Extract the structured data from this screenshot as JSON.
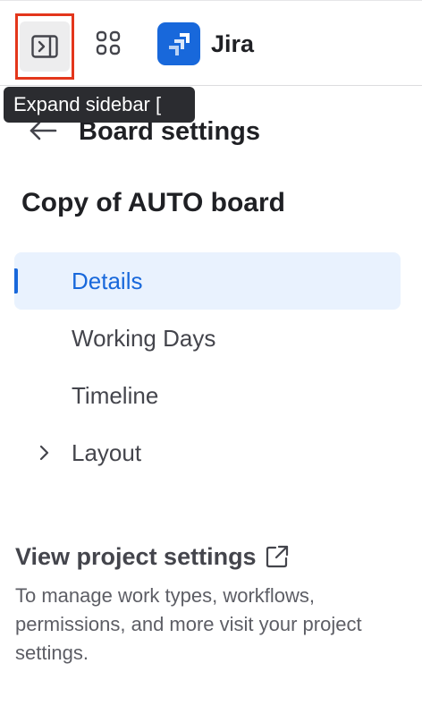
{
  "topbar": {
    "product_name": "Jira",
    "tooltip": "Expand sidebar ["
  },
  "header": {
    "title": "Board settings",
    "board_name": "Copy of AUTO board"
  },
  "nav": {
    "items": [
      {
        "label": "Details",
        "active": true
      },
      {
        "label": "Working Days",
        "active": false
      },
      {
        "label": "Timeline",
        "active": false
      },
      {
        "label": "Layout",
        "active": false,
        "expandable": true
      }
    ]
  },
  "footer": {
    "link_label": "View project settings",
    "description": "To manage work types, workflows, permissions, and more visit your project settings."
  },
  "colors": {
    "accent": "#1868db",
    "active_bg": "#e9f2fe",
    "highlight_border": "#e3361b",
    "tooltip_bg": "#2b2c30"
  },
  "icons": {
    "sidebar_toggle": "expand-sidebar-icon",
    "apps": "app-switcher-icon",
    "logo": "jira-logo-icon",
    "back": "arrow-left-icon",
    "chevron": "chevron-right-icon",
    "external": "external-link-icon"
  }
}
